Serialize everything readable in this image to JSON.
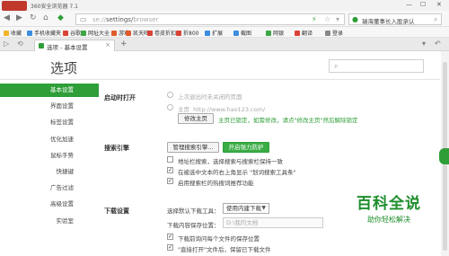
{
  "titlebar": {
    "title": "360安全浏览器 7.1",
    "minimize": "—",
    "maximize": "☐",
    "close": "✕"
  },
  "navbar": {
    "url_scheme": "se://",
    "url_path": "settings/",
    "url_rest": "browser",
    "search_text": "瑞海董事长入股承认"
  },
  "bookmarks": [
    {
      "label": "收藏",
      "color": "#f1b32a"
    },
    {
      "label": "手机收藏夹",
      "color": "#3c8dde"
    },
    {
      "label": "谷歌",
      "color": "#d94336"
    },
    {
      "label": "网址大全",
      "color": "#3aa845"
    },
    {
      "label": "游戏",
      "color": "#e05a2b"
    },
    {
      "label": "凯天旺",
      "color": "#e05a2b"
    },
    {
      "label": "卷皮折扣",
      "color": "#d94336"
    },
    {
      "label": "折800",
      "color": "#d94336"
    },
    {
      "label": "扩展",
      "color": "#3c8dde"
    },
    {
      "label": "截图",
      "color": "#3c8dde"
    },
    {
      "label": "网银",
      "color": "#3aa845"
    },
    {
      "label": "翻译",
      "color": "#d94336"
    },
    {
      "label": "登录",
      "color": "#888888"
    }
  ],
  "tab": {
    "title": "选项 - 基本设置",
    "close": "×",
    "new_tab": "+"
  },
  "page": {
    "title": "选项"
  },
  "sidebar": {
    "items": [
      {
        "label": "基本设置"
      },
      {
        "label": "界面设置"
      },
      {
        "label": "标签设置"
      },
      {
        "label": "优化加速"
      },
      {
        "label": "鼠标手势"
      },
      {
        "label": "快捷键"
      },
      {
        "label": "广告过滤"
      },
      {
        "label": "高级设置"
      },
      {
        "label": "实验室"
      }
    ]
  },
  "startup": {
    "label": "启动时打开",
    "opt_last": "上次退出时未关闭的页面",
    "opt_home_prefix": "主页",
    "home_url": "http://www.hao123.com/",
    "modify_btn": "修改主页",
    "locked_hint": "主页已锁定，如需修改，请点\"修改主页\"然后解除锁定"
  },
  "search_engine": {
    "label": "搜索引擎",
    "manage_btn": "管理搜索引擎...",
    "protect_btn": "开启强力防护",
    "opt1": "地址栏搜索，选择搜索与搜索栏保持一致",
    "opt2": "在被选中文本的右上角显示 \"划词搜索工具条\"",
    "opt3": "启用搜索栏的热搜词推荐功能"
  },
  "download": {
    "label": "下载设置",
    "tool_label": "选择默认下载工具：",
    "tool_value": "使用内建下载",
    "dir_label": "下载内容保存位置：",
    "dir_value": "D:\\我的文档",
    "opt1": "下载前询问每个文件的保存位置",
    "opt2": "\"直接打开\"文件后，保留已下载文件"
  },
  "watermark": {
    "main": "百科全说",
    "sub": "助你轻松解决"
  }
}
